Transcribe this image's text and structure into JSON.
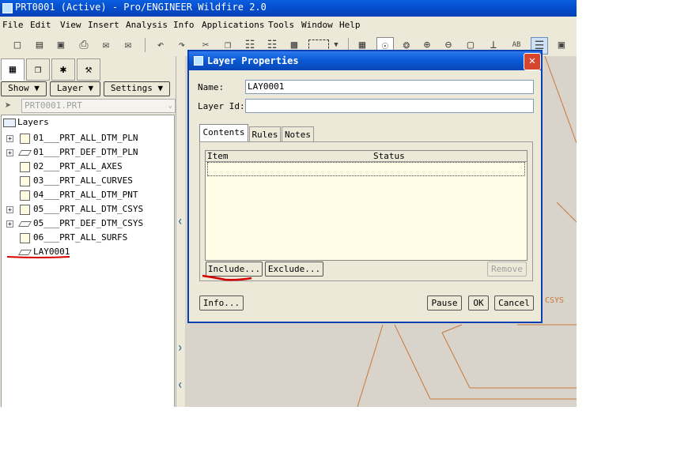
{
  "window": {
    "title": "PRT0001 (Active) - Pro/ENGINEER Wildfire 2.0"
  },
  "menu": [
    "File",
    "Edit",
    "View",
    "Insert",
    "Analysis",
    "Info",
    "Applications",
    "Tools",
    "Window",
    "Help"
  ],
  "left_panel": {
    "show_label": "Show",
    "layer_label": "Layer",
    "settings_label": "Settings",
    "model_value": "PRT0001.PRT",
    "tree_root": "Layers",
    "tree_items": [
      {
        "label": "01___PRT_ALL_DTM_PLN",
        "icon": "layer-icon",
        "expandable": true
      },
      {
        "label": "01___PRT_DEF_DTM_PLN",
        "icon": "plane-icon",
        "expandable": true
      },
      {
        "label": "02___PRT_ALL_AXES",
        "icon": "layer-icon",
        "expandable": false
      },
      {
        "label": "03___PRT_ALL_CURVES",
        "icon": "layer-icon",
        "expandable": false
      },
      {
        "label": "04___PRT_ALL_DTM_PNT",
        "icon": "layer-icon",
        "expandable": false
      },
      {
        "label": "05___PRT_ALL_DTM_CSYS",
        "icon": "layer-icon",
        "expandable": true
      },
      {
        "label": "05___PRT_DEF_DTM_CSYS",
        "icon": "plane-icon",
        "expandable": true
      },
      {
        "label": "06___PRT_ALL_SURFS",
        "icon": "layer-icon",
        "expandable": false
      },
      {
        "label": "LAY0001",
        "icon": "plane-icon",
        "expandable": false
      }
    ]
  },
  "graphics": {
    "csys_label": "CSYS"
  },
  "dialog": {
    "title": "Layer Properties",
    "name_label": "Name:",
    "name_value": "LAY0001",
    "layer_id_label": "Layer Id:",
    "layer_id_value": "",
    "tabs": [
      "Contents",
      "Rules",
      "Notes"
    ],
    "columns": [
      "Item",
      "Status"
    ],
    "include_label": "Include...",
    "exclude_label": "Exclude...",
    "remove_label": "Remove",
    "info_label": "Info...",
    "pause_label": "Pause",
    "ok_label": "OK",
    "cancel_label": "Cancel"
  },
  "colors": {
    "annotation": "#d40000",
    "title_bar": "#0a5fe0",
    "model_line": "#c8783a"
  }
}
